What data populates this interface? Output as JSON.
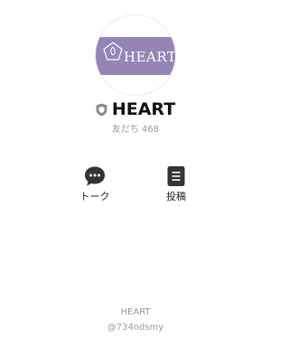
{
  "profile": {
    "avatar_text": "HEART",
    "name": "HEART",
    "friends": "友だち 468",
    "badge_icon": "shield-badge-icon"
  },
  "actions": [
    {
      "label": "トーク",
      "icon": "chat-bubble-icon"
    },
    {
      "label": "投稿",
      "icon": "post-document-icon"
    }
  ],
  "footer": {
    "name": "HEART",
    "line_id": "@734odsmy"
  },
  "colors": {
    "avatar_band": "#9585b6",
    "icon_dark": "#33333a",
    "muted_text": "#9a9a9a"
  }
}
